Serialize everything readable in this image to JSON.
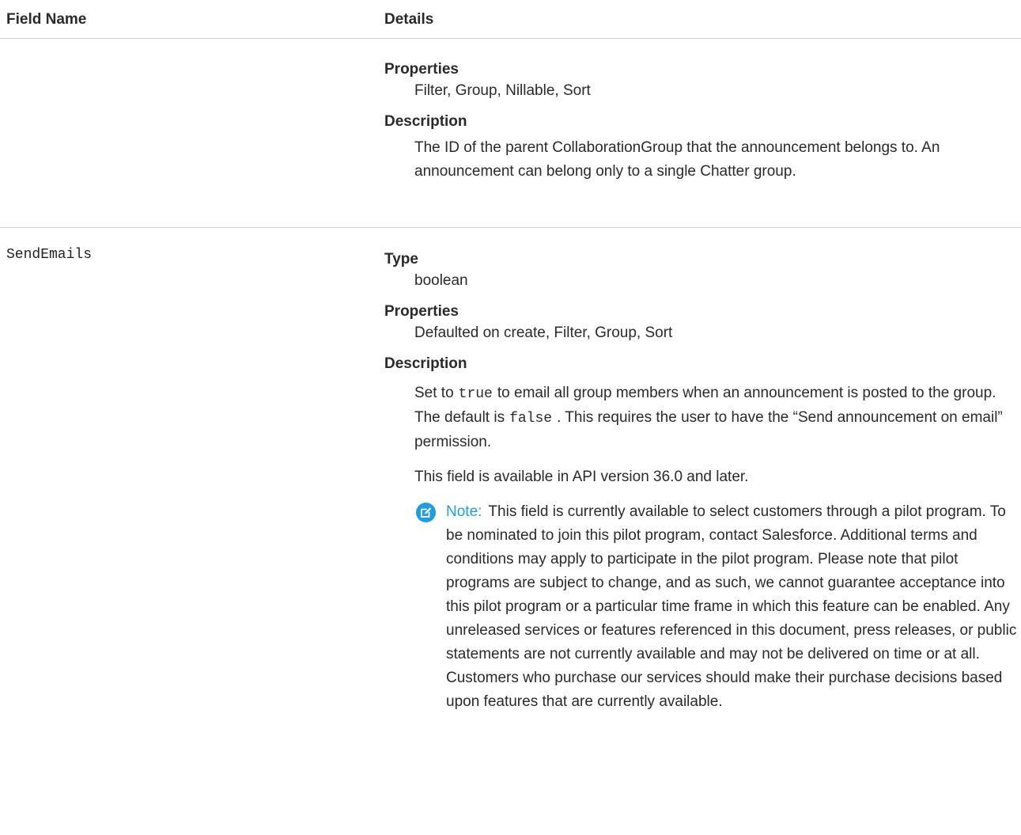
{
  "header": {
    "field_name": "Field Name",
    "details": "Details"
  },
  "rows": [
    {
      "field_name": "",
      "properties_label": "Properties",
      "properties_value": "Filter, Group, Nillable, Sort",
      "description_label": "Description",
      "description": "The ID of the parent CollaborationGroup that the announcement belongs to. An announcement can belong only to a single Chatter group."
    },
    {
      "field_name": "SendEmails",
      "type_label": "Type",
      "type_value": "boolean",
      "properties_label": "Properties",
      "properties_value": "Defaulted on create, Filter, Group, Sort",
      "description_label": "Description",
      "description_parts": {
        "p1_a": "Set to",
        "p1_code1": "true",
        "p1_b": "to email all group members when an announcement is posted to the group. The default is",
        "p1_code2": "false",
        "p1_c": ". This requires the user to have the “Send announcement on email” permission."
      },
      "availability": "This field is available in API version 36.0 and later.",
      "note_label": "Note:",
      "note_text": "This field is currently available to select customers through a pilot program. To be nominated to join this pilot program, contact Salesforce. Additional terms and conditions may apply to participate in the pilot program. Please note that pilot programs are subject to change, and as such, we cannot guarantee acceptance into this pilot program or a particular time frame in which this feature can be enabled. Any unreleased services or features referenced in this document, press releases, or public statements are not currently available and may not be delivered on time or at all. Customers who purchase our services should make their purchase decisions based upon features that are currently available."
    }
  ],
  "colors": {
    "note_accent": "#1e9ee0",
    "divider": "#cfcfcf"
  },
  "icons": {
    "note": "edit-note-icon"
  }
}
